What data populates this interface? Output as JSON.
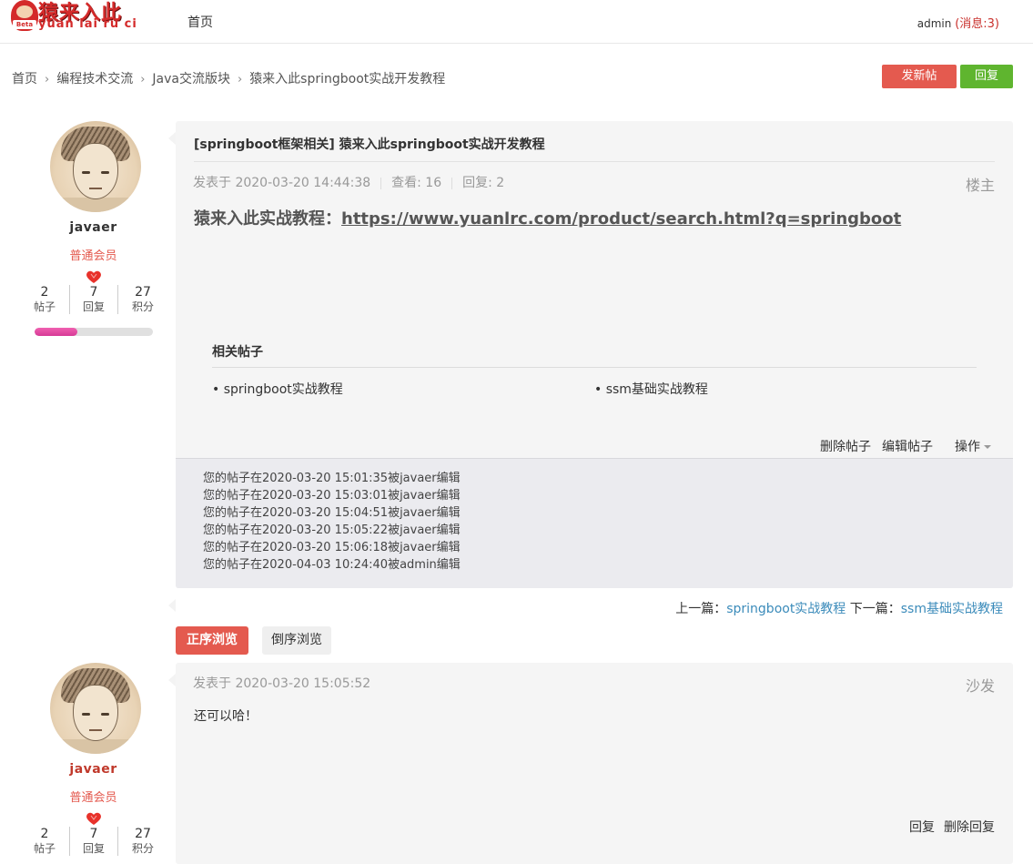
{
  "header": {
    "logo_cn": "猿来入此",
    "logo_en": "yuan lai ru ci",
    "logo_badge": "Beta",
    "nav_home": "首页",
    "user_name": "admin",
    "messages": "(消息:3)"
  },
  "breadcrumb": [
    "首页",
    "编程技术交流",
    "Java交流版块",
    "猿来入此springboot实战开发教程"
  ],
  "breadcrumb_sep": "›",
  "actions": {
    "new_post": "发新帖",
    "reply": "回复"
  },
  "author": {
    "name": "javaer",
    "role": "普通会员",
    "stats": [
      {
        "num": "2",
        "label": "帖子"
      },
      {
        "num": "7",
        "label": "回复"
      },
      {
        "num": "27",
        "label": "积分"
      }
    ],
    "level_progress": 0.36
  },
  "post": {
    "title": "[springboot框架相关] 猿来入此springboot实战开发教程",
    "posted_at": "发表于 2020-03-20 14:44:38",
    "views": "查看: 16",
    "replies": "回复: 2",
    "floor": "楼主",
    "content_label": "猿来入此实战教程：",
    "content_link": "https://www.yuanlrc.com/product/search.html?q=springboot",
    "related_title": "相关帖子",
    "related": [
      "• springboot实战教程",
      "• ssm基础实战教程"
    ],
    "ops": {
      "delete": "删除帖子",
      "edit": "编辑帖子",
      "more": "操作"
    },
    "edit_log": [
      "您的帖子在2020-03-20 15:01:35被javaer编辑",
      "您的帖子在2020-03-20 15:03:01被javaer编辑",
      "您的帖子在2020-03-20 15:04:51被javaer编辑",
      "您的帖子在2020-03-20 15:05:22被javaer编辑",
      "您的帖子在2020-03-20 15:06:18被javaer编辑",
      "您的帖子在2020-04-03 10:24:40被admin编辑"
    ]
  },
  "prev_next": {
    "prev_label": "上一篇：",
    "prev_title": "springboot实战教程",
    "next_label": "下一篇：",
    "next_title": "ssm基础实战教程"
  },
  "sort": {
    "asc": "正序浏览",
    "desc": "倒序浏览"
  },
  "reply1": {
    "author": {
      "name": "javaer",
      "role": "普通会员",
      "stats": [
        {
          "num": "2",
          "label": "帖子"
        },
        {
          "num": "7",
          "label": "回复"
        },
        {
          "num": "27",
          "label": "积分"
        }
      ]
    },
    "posted_at": "发表于 2020-03-20 15:05:52",
    "floor": "沙发",
    "text": "还可以哈！",
    "ops": {
      "reply": "回复",
      "delete": "删除回复"
    }
  },
  "colors": {
    "accent_red": "#e45a4f",
    "accent_green": "#5fb52f",
    "link_blue": "#3b8bba",
    "panel_bg": "#f5f5f5"
  }
}
